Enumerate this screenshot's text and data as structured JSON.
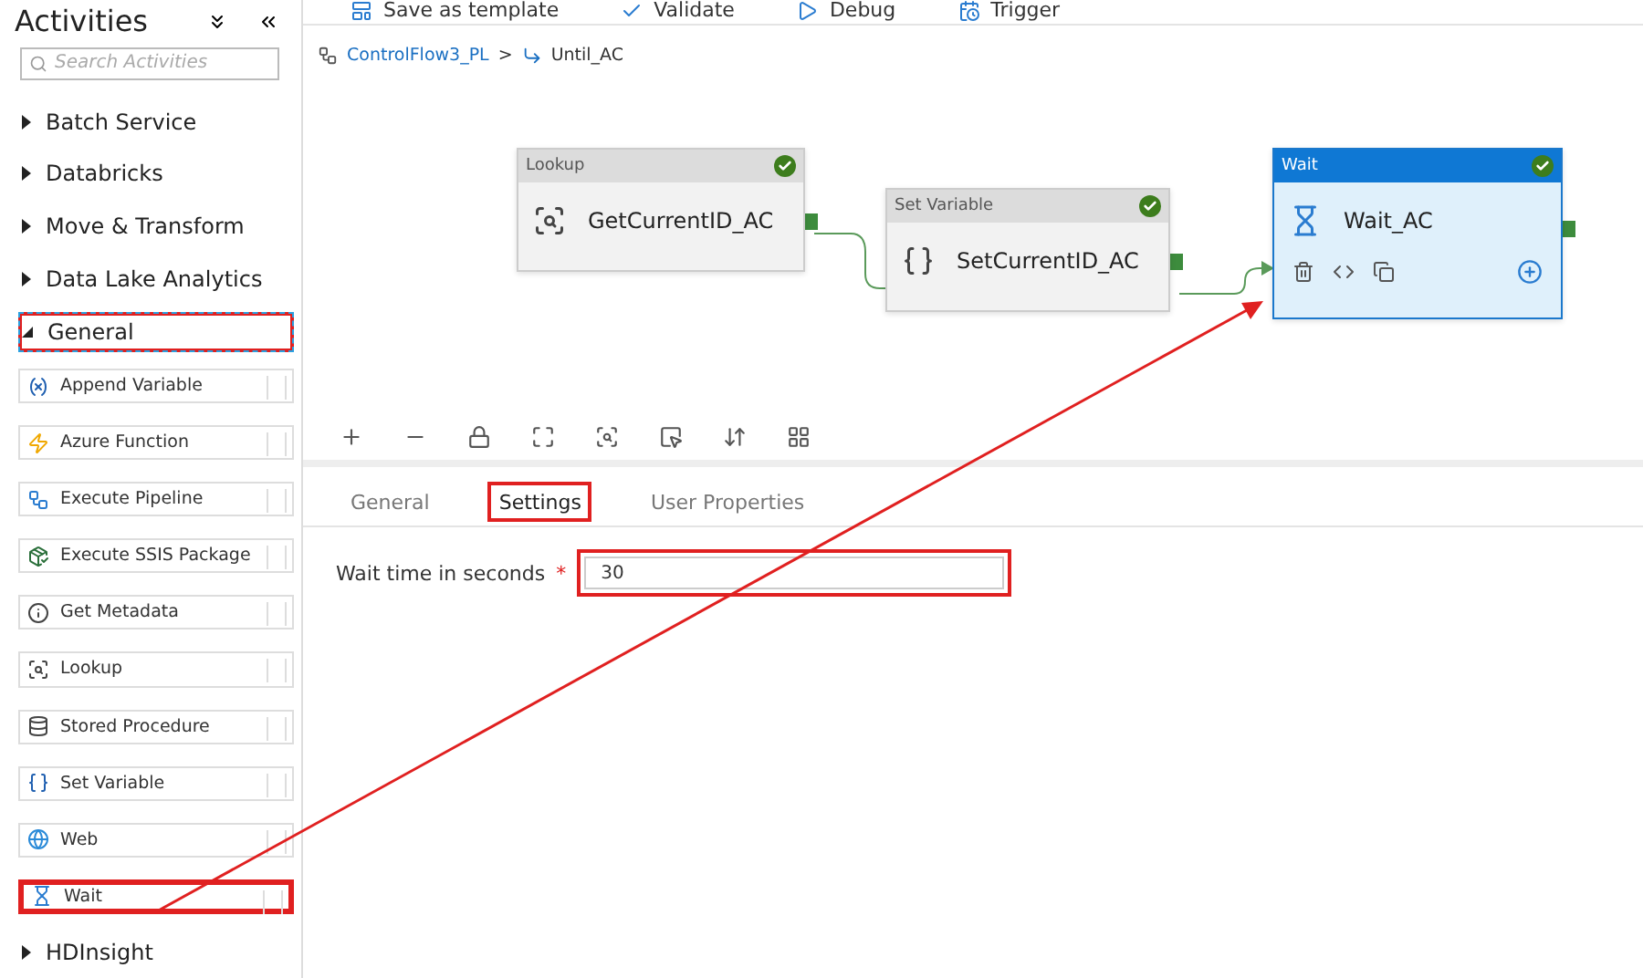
{
  "sidebar": {
    "title": "Activities",
    "search": {
      "placeholder": "Search Activities"
    },
    "categories": [
      {
        "label": "Batch Service",
        "expanded": false,
        "highlighted": false
      },
      {
        "label": "Databricks",
        "expanded": false,
        "highlighted": false
      },
      {
        "label": "Move & Transform",
        "expanded": false,
        "highlighted": false
      },
      {
        "label": "Data Lake Analytics",
        "expanded": false,
        "highlighted": false
      },
      {
        "label": "General",
        "expanded": true,
        "highlighted": true,
        "children": [
          {
            "label": "Append Variable",
            "kind": "append",
            "highlighted": false
          },
          {
            "label": "Azure Function",
            "kind": "function",
            "highlighted": false
          },
          {
            "label": "Execute Pipeline",
            "kind": "pipeline",
            "highlighted": false
          },
          {
            "label": "Execute SSIS Package",
            "kind": "ssis",
            "highlighted": false
          },
          {
            "label": "Get Metadata",
            "kind": "metadata",
            "highlighted": false
          },
          {
            "label": "Lookup",
            "kind": "lookup",
            "highlighted": false
          },
          {
            "label": "Stored Procedure",
            "kind": "procedure",
            "highlighted": false
          },
          {
            "label": "Set Variable",
            "kind": "variable",
            "highlighted": false
          },
          {
            "label": "Web",
            "kind": "web",
            "highlighted": false
          },
          {
            "label": "Wait",
            "kind": "wait",
            "highlighted": true
          }
        ]
      },
      {
        "label": "HDInsight",
        "expanded": false,
        "highlighted": false
      }
    ]
  },
  "toolbar": [
    {
      "label": "Save as template",
      "kind": "template"
    },
    {
      "label": "Validate",
      "kind": "validate"
    },
    {
      "label": "Debug",
      "kind": "debug"
    },
    {
      "label": "Trigger",
      "kind": "trigger"
    }
  ],
  "breadcrumb": {
    "items": [
      "ControlFlow3_PL",
      "Until_AC"
    ],
    "separator": ">"
  },
  "canvas": {
    "nodes": [
      {
        "type": "Lookup",
        "name": "GetCurrentID_AC",
        "kind": "lookup",
        "selected": false
      },
      {
        "type": "Set Variable",
        "name": "SetCurrentID_AC",
        "kind": "variable",
        "selected": false
      },
      {
        "type": "Wait",
        "name": "Wait_AC",
        "kind": "wait",
        "selected": true
      }
    ]
  },
  "panel": {
    "tabs": [
      {
        "label": "General",
        "selected": false,
        "highlighted": false
      },
      {
        "label": "Settings",
        "selected": true,
        "highlighted": true
      },
      {
        "label": "User Properties",
        "selected": false,
        "highlighted": false
      }
    ],
    "fields": [
      {
        "label": "Wait time in seconds",
        "required_mark": "*",
        "value": "30",
        "highlighted": true
      }
    ]
  }
}
